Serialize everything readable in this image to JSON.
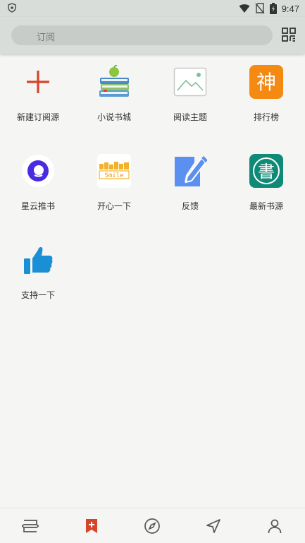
{
  "status_bar": {
    "time": "9:47",
    "icons": [
      "shield-icon",
      "wifi-icon",
      "no-sim-icon",
      "battery-charging-icon"
    ]
  },
  "search": {
    "placeholder": "订阅",
    "qr_icon": "qr-scan-icon"
  },
  "tiles": [
    {
      "label": "新建订阅源",
      "icon": "plus-icon"
    },
    {
      "label": "小说书城",
      "icon": "books-apple-icon"
    },
    {
      "label": "阅读主题",
      "icon": "image-placeholder-icon"
    },
    {
      "label": "排行榜",
      "icon": "shen-character-icon",
      "icon_text": "神"
    },
    {
      "label": "星云推书",
      "icon": "nebula-icon"
    },
    {
      "label": "开心一下",
      "icon": "smile-icon",
      "icon_text": "Smile"
    },
    {
      "label": "反馈",
      "icon": "edit-note-icon"
    },
    {
      "label": "最新书源",
      "icon": "shu-character-icon",
      "icon_text": "書"
    },
    {
      "label": "支持一下",
      "icon": "thumbs-up-icon"
    }
  ],
  "bottom_nav": [
    {
      "name": "bookshelf",
      "icon": "bookshelf-icon",
      "active": false
    },
    {
      "name": "subscription",
      "icon": "bookmark-plus-icon",
      "active": true
    },
    {
      "name": "discover",
      "icon": "compass-icon",
      "active": false
    },
    {
      "name": "rss",
      "icon": "navigation-arrow-icon",
      "active": false
    },
    {
      "name": "profile",
      "icon": "person-icon",
      "active": false
    }
  ],
  "colors": {
    "accent": "#d6442a",
    "status_bar": "#d8ddd9",
    "background": "#f5f5f3",
    "icon_gray": "#555555"
  }
}
